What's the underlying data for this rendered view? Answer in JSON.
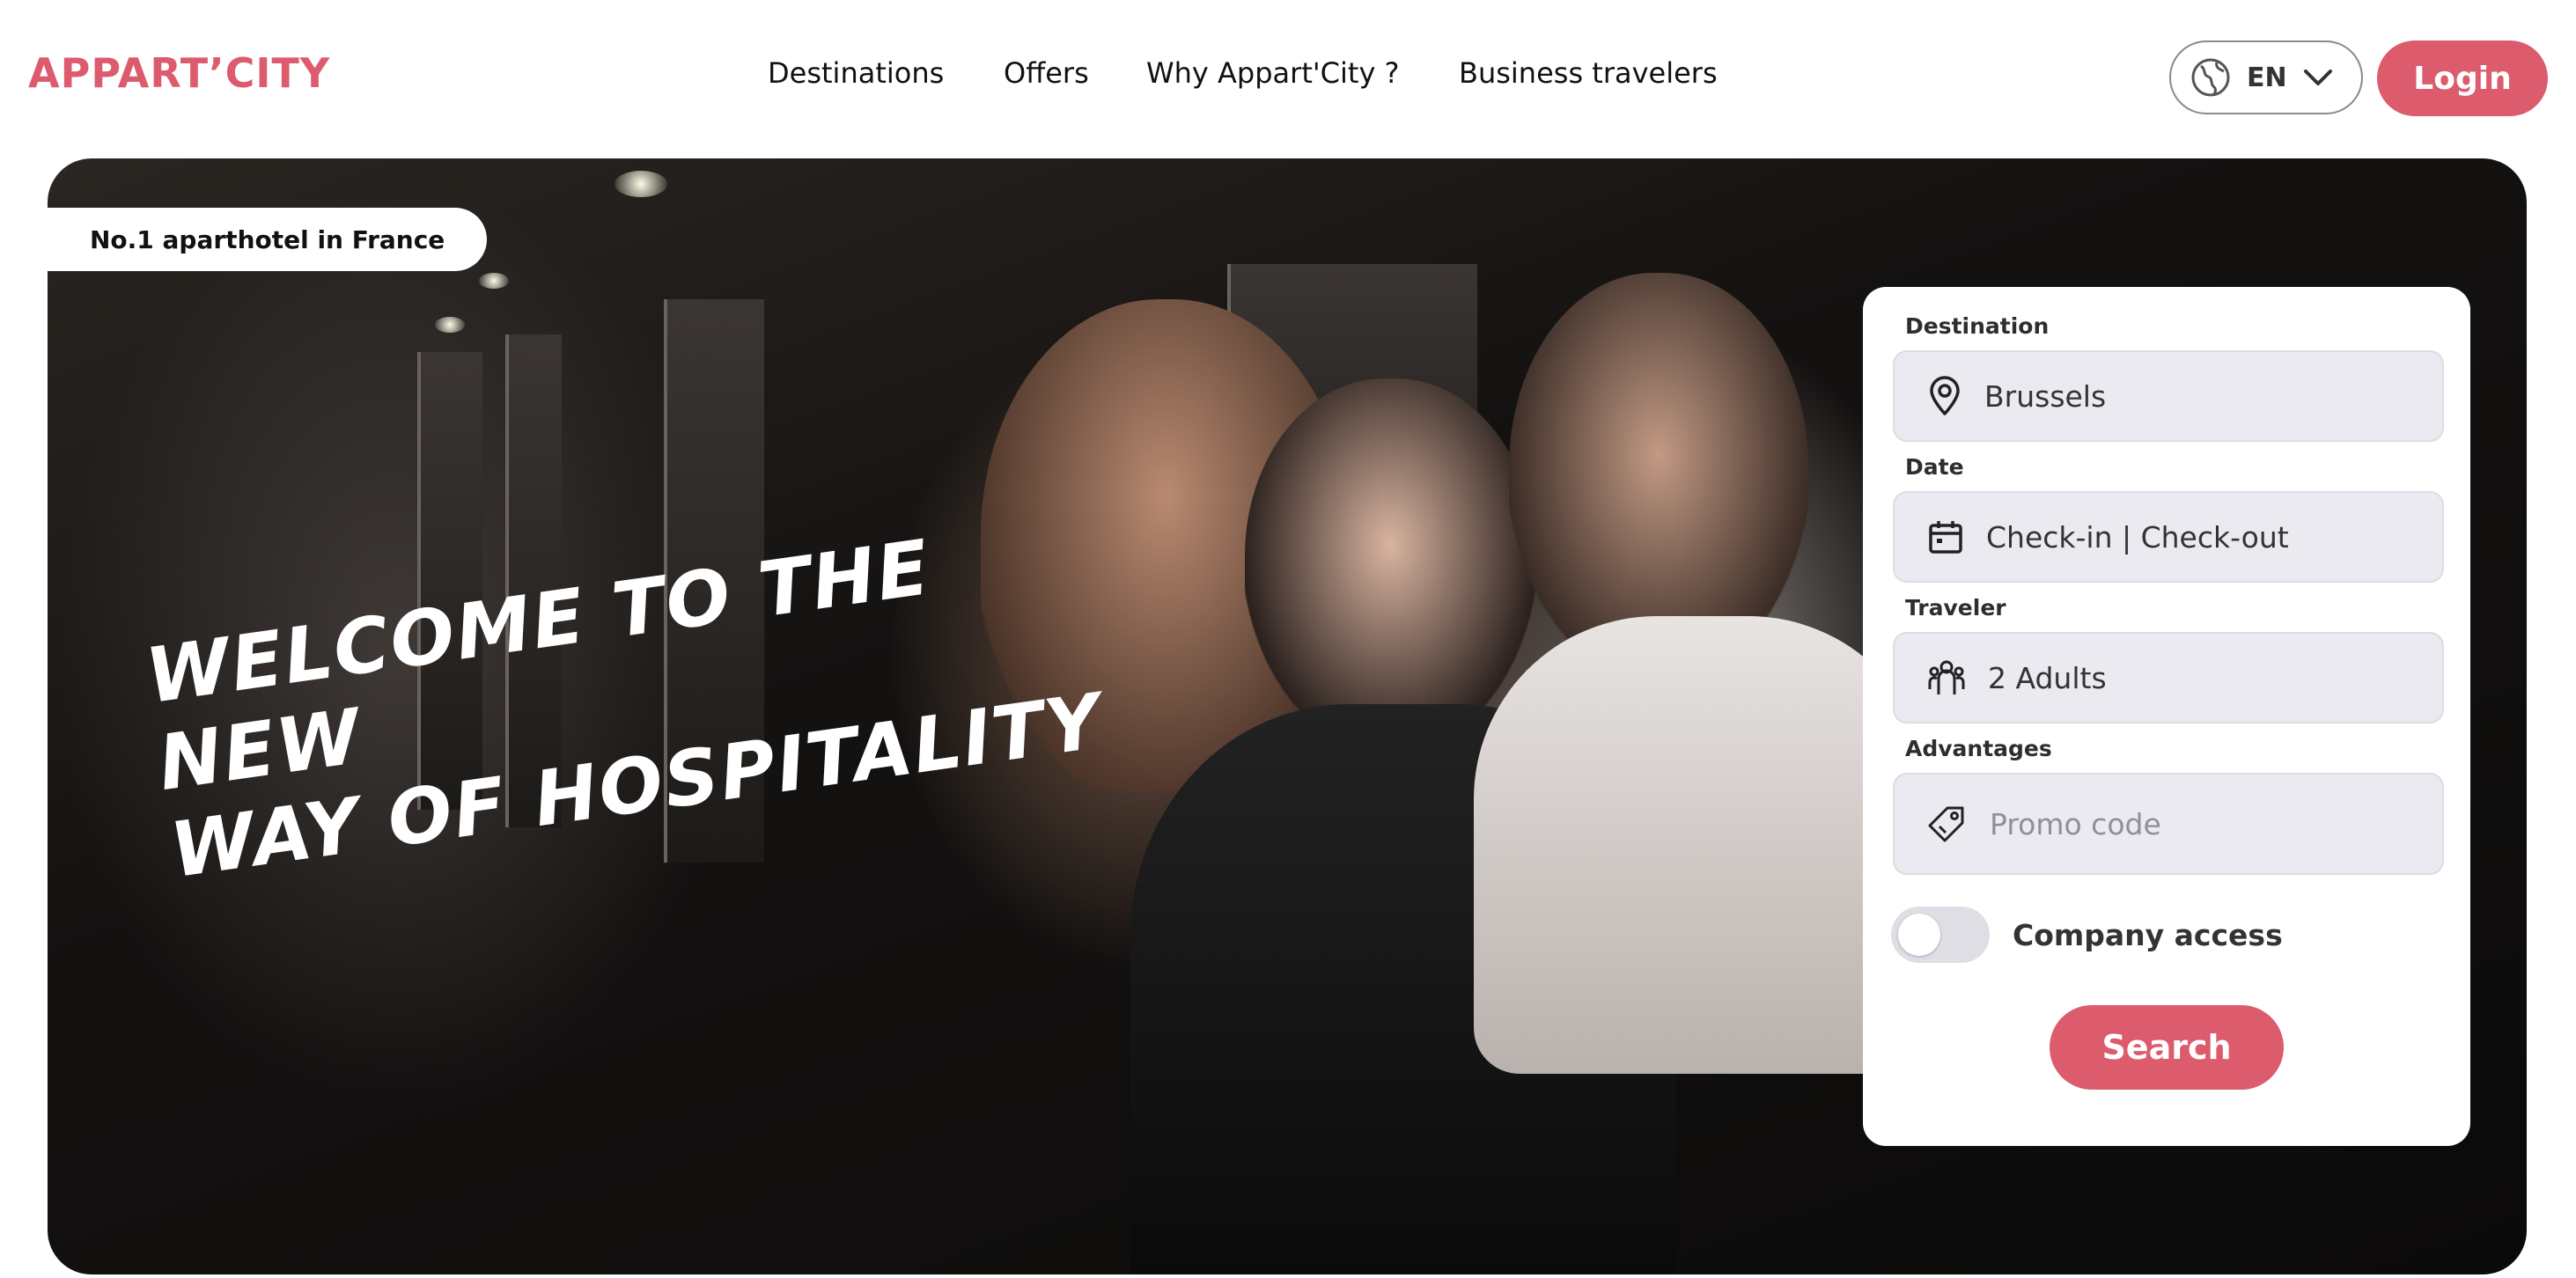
{
  "header": {
    "logo": "APPART’CITY",
    "nav": [
      "Destinations",
      "Offers",
      "Why Appart'City ?",
      "Business travelers"
    ],
    "language": {
      "code": "EN",
      "icon": "globe-icon"
    },
    "login_label": "Login"
  },
  "hero": {
    "badge": "No.1 aparthotel in France",
    "tagline_line1": "Welcome to the new",
    "tagline_line2": "way of hospitality"
  },
  "search": {
    "destination": {
      "label": "Destination",
      "value": "Brussels",
      "icon": "location-pin-icon"
    },
    "date": {
      "label": "Date",
      "value": "Check-in | Check-out",
      "icon": "calendar-icon"
    },
    "traveler": {
      "label": "Traveler",
      "value": "2 Adults",
      "icon": "people-icon"
    },
    "advantages": {
      "label": "Advantages",
      "placeholder": "Promo code",
      "icon": "tag-icon"
    },
    "company_access": {
      "label": "Company access",
      "enabled": false
    },
    "button_label": "Search"
  },
  "colors": {
    "brand": "#dc5b6d",
    "field_bg": "#eaeaf0"
  }
}
